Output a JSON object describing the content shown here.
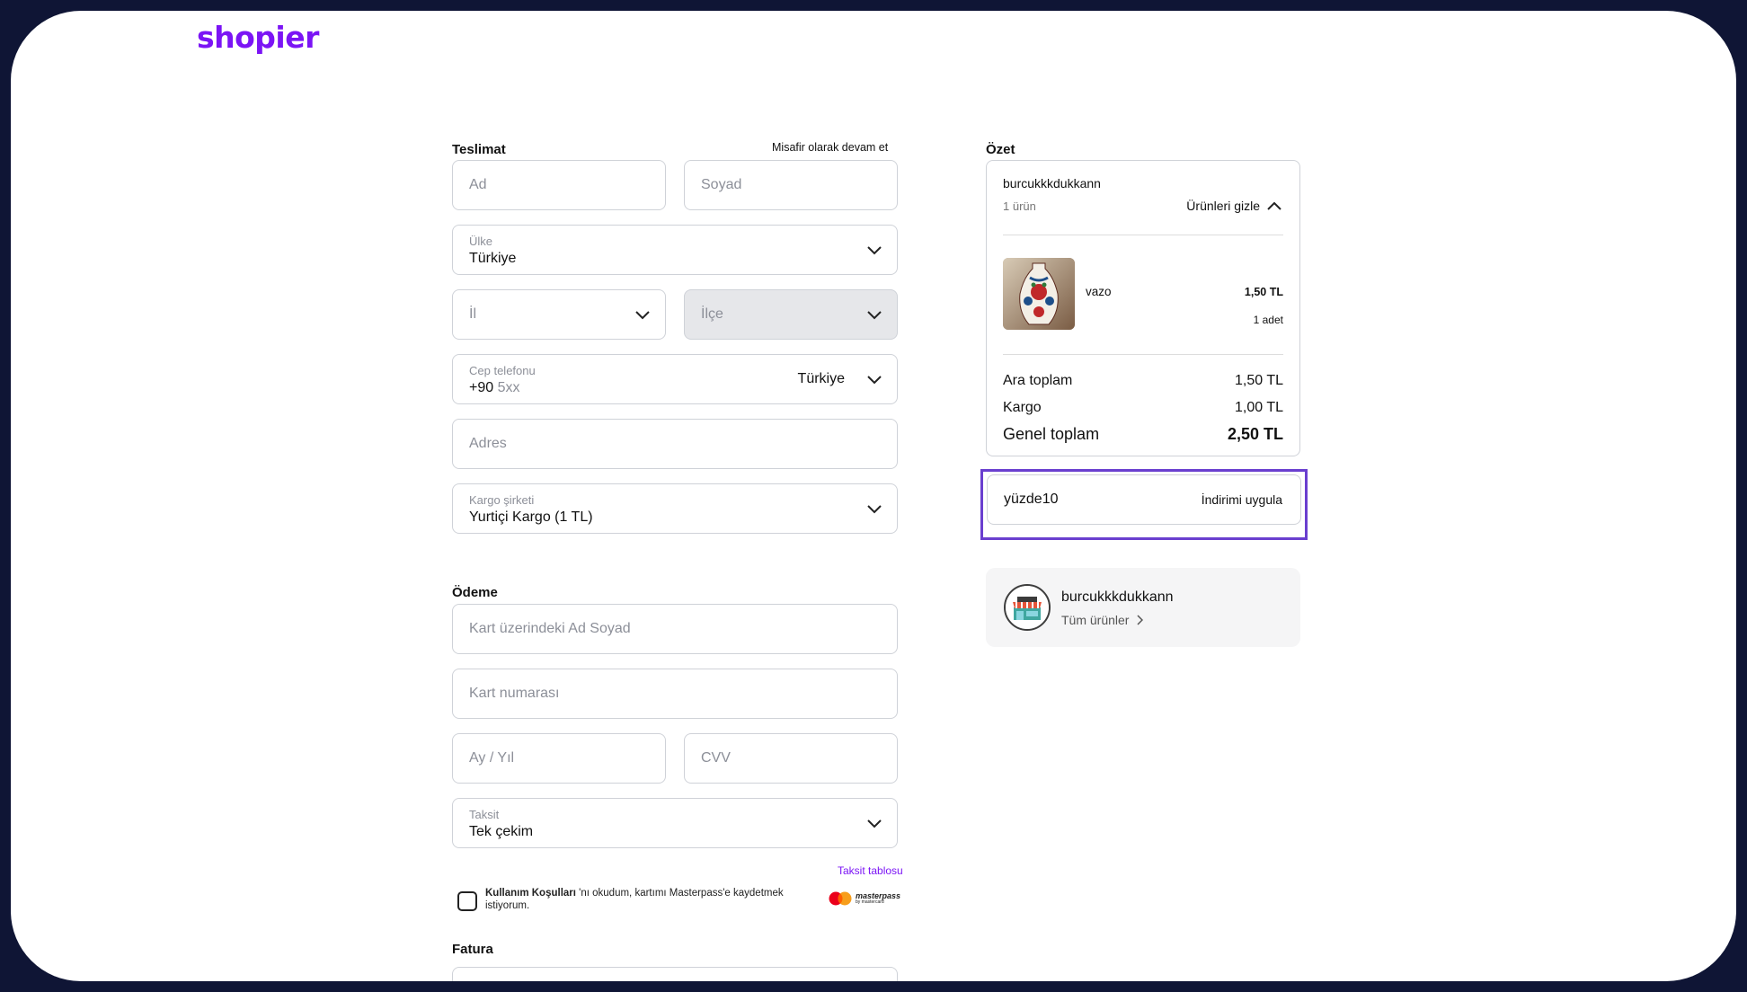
{
  "brand": {
    "logo": "shopier"
  },
  "delivery": {
    "title": "Teslimat",
    "guest_link": "Misafir olarak devam et",
    "first_name_placeholder": "Ad",
    "last_name_placeholder": "Soyad",
    "country": {
      "label": "Ülke",
      "value": "Türkiye"
    },
    "province_placeholder": "İl",
    "district_placeholder": "İlçe",
    "phone": {
      "label": "Cep telefonu",
      "prefix": "+90",
      "placeholder": "5xx",
      "country": "Türkiye"
    },
    "address_placeholder": "Adres",
    "cargo": {
      "label": "Kargo şirketi",
      "value": "Yurtiçi Kargo (1 TL)"
    }
  },
  "payment": {
    "title": "Ödeme",
    "card_name_placeholder": "Kart üzerindeki Ad Soyad",
    "card_number_placeholder": "Kart numarası",
    "expiry_placeholder": "Ay / Yıl",
    "cvv_placeholder": "CVV",
    "installment": {
      "label": "Taksit",
      "value": "Tek çekim"
    },
    "installment_table_link": "Taksit tablosu",
    "terms_bold": "Kullanım Koşulları",
    "terms_rest": " 'nı okudum, kartımı Masterpass'e kaydetmek istiyorum.",
    "masterpass": "masterpass",
    "masterpass_sub": "by mastercard"
  },
  "invoice": {
    "title": "Fatura"
  },
  "summary": {
    "title": "Özet",
    "shop_name": "burcukkkdukkann",
    "item_count": "1 ürün",
    "hide_products": "Ürünleri gizle",
    "item": {
      "name": "vazo",
      "price": "1,50 TL",
      "qty": "1 adet"
    },
    "subtotal_label": "Ara toplam",
    "subtotal_value": "1,50 TL",
    "shipping_label": "Kargo",
    "shipping_value": "1,00 TL",
    "total_label": "Genel toplam",
    "total_value": "2,50 TL"
  },
  "discount": {
    "code": "yüzde10",
    "apply_label": "İndirimi uygula"
  },
  "shop_card": {
    "name": "burcukkkdukkann",
    "link": "Tüm ürünler"
  },
  "colors": {
    "brand": "#7b14f5",
    "highlight": "#6a3fcf",
    "frame": "#0f1535"
  }
}
